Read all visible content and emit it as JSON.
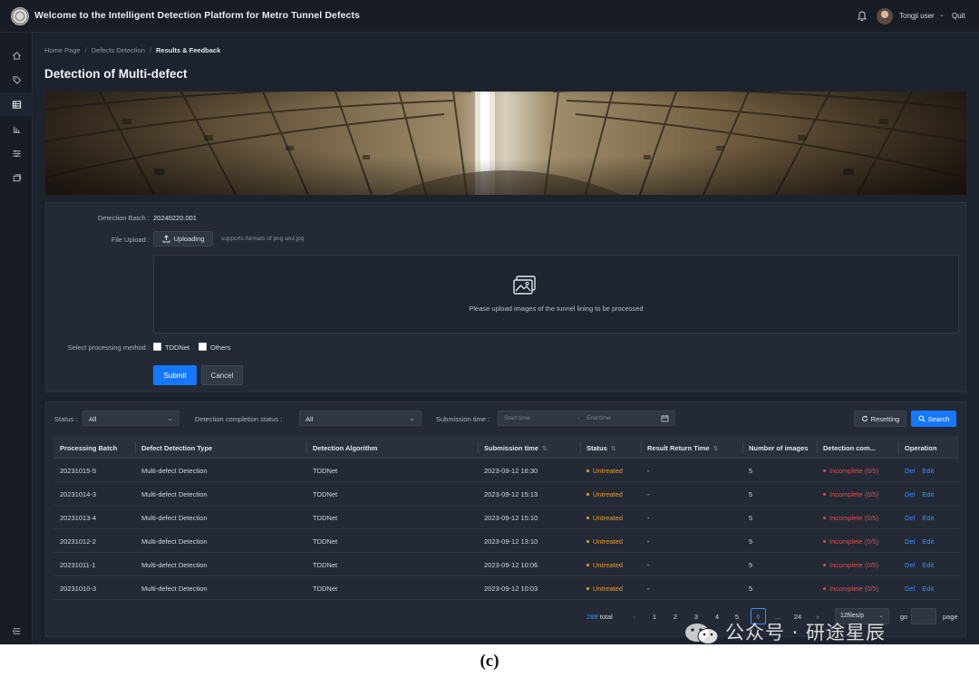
{
  "header": {
    "title": "Welcome to the Intelligent Detection Platform for Metro Tunnel Defects",
    "user_name": "Tongji user",
    "quit_label": "Quit"
  },
  "sidebar": {
    "items": [
      {
        "icon": "home-icon"
      },
      {
        "icon": "tag-icon"
      },
      {
        "icon": "table-icon",
        "active": true
      },
      {
        "icon": "chart-icon"
      },
      {
        "icon": "sliders-icon"
      },
      {
        "icon": "layers-icon"
      }
    ],
    "bottom_icon": "collapse-icon"
  },
  "breadcrumb": {
    "items": [
      "Home Page",
      "Defects Detection",
      "Results & Feedback"
    ],
    "separator": "/"
  },
  "page_title": "Detection of Multi-defect",
  "form": {
    "batch_label": "Detection Batch :",
    "batch_value": "20240220.001",
    "upload_label": "File Upload :",
    "upload_button": "Uploading",
    "upload_hint": "supports formats of png and jpg",
    "dropzone_text": "Please upload images of the tunnel lining to be processed",
    "method_label": "Select processing method :",
    "methods": [
      {
        "label": "TDDNet",
        "checked": false
      },
      {
        "label": "Others",
        "checked": false
      }
    ],
    "submit_label": "Submit",
    "cancel_label": "Cancel"
  },
  "filters": {
    "status_label": "Status :",
    "status_value": "All",
    "completion_label": "Detection completion status :",
    "completion_value": "All",
    "submission_label": "Submission time :",
    "start_placeholder": "Start time",
    "range_separator": "-",
    "end_placeholder": "End time",
    "reset_label": "Resetting",
    "search_label": "Search"
  },
  "table": {
    "columns": [
      {
        "label": "Processing Batch",
        "sortable": false
      },
      {
        "label": "Defect Detection Type",
        "sortable": false
      },
      {
        "label": "Detection Algorithm",
        "sortable": false
      },
      {
        "label": "Submission time",
        "sortable": true
      },
      {
        "label": "Status",
        "sortable": true
      },
      {
        "label": "Result Return Time",
        "sortable": true
      },
      {
        "label": "Number of images",
        "sortable": false
      },
      {
        "label": "Detection com...",
        "sortable": false
      },
      {
        "label": "Operation",
        "sortable": false
      }
    ],
    "sort_glyph": "⇅",
    "rows": [
      {
        "batch": "20231015-5",
        "type": "Multi-defect Detection",
        "algorithm": "TDDNet",
        "submitted": "2023-09-12  16:30",
        "status": "Untreated",
        "returned": "-",
        "images": "5",
        "completion": "Incomplete (0/5)",
        "op_del": "Del",
        "op_edit": "Edit"
      },
      {
        "batch": "20231014-3",
        "type": "Multi-defect Detection",
        "algorithm": "TDDNet",
        "submitted": "2023-09-12  15:13",
        "status": "Untreated",
        "returned": "-",
        "images": "5",
        "completion": "Incomplete (0/5)",
        "op_del": "Del",
        "op_edit": "Edit"
      },
      {
        "batch": "20231013-4",
        "type": "Multi-defect Detection",
        "algorithm": "TDDNet",
        "submitted": "2023-09-12  15:10",
        "status": "Untreated",
        "returned": "-",
        "images": "5",
        "completion": "Incomplete (0/5)",
        "op_del": "Del",
        "op_edit": "Edit"
      },
      {
        "batch": "20231012-2",
        "type": "Multi-defect Detection",
        "algorithm": "TDDNet",
        "submitted": "2023-09-12  13:10",
        "status": "Untreated",
        "returned": "-",
        "images": "5",
        "completion": "Incomplete (0/5)",
        "op_del": "Del",
        "op_edit": "Edit"
      },
      {
        "batch": "20231011-1",
        "type": "Multi-defect Detection",
        "algorithm": "TDDNet",
        "submitted": "2023-09-12  10:06",
        "status": "Untreated",
        "returned": "-",
        "images": "5",
        "completion": "Incomplete (0/5)",
        "op_del": "Del",
        "op_edit": "Edit"
      },
      {
        "batch": "20231010-3",
        "type": "Multi-defect Detection",
        "algorithm": "TDDNet",
        "submitted": "2023-09-12  10:03",
        "status": "Untreated",
        "returned": "-",
        "images": "5",
        "completion": "Incomplete (0/5)",
        "op_del": "Del",
        "op_edit": "Edit"
      }
    ]
  },
  "pagination": {
    "total_count": "288",
    "total_label": "total",
    "prev": "‹",
    "next": "›",
    "pages": [
      "1",
      "2",
      "3",
      "4",
      "5",
      "6",
      "...",
      "24"
    ],
    "current_page": "6",
    "page_size": "12files/p",
    "go_label": "go",
    "page_label": "page"
  },
  "colors": {
    "accent": "#1677ff",
    "status_untreated": "#f0a030",
    "status_incomplete": "#e14b4b",
    "background": "#1d232e"
  },
  "watermark": "公众号 · 研途星辰",
  "caption": "(c)"
}
